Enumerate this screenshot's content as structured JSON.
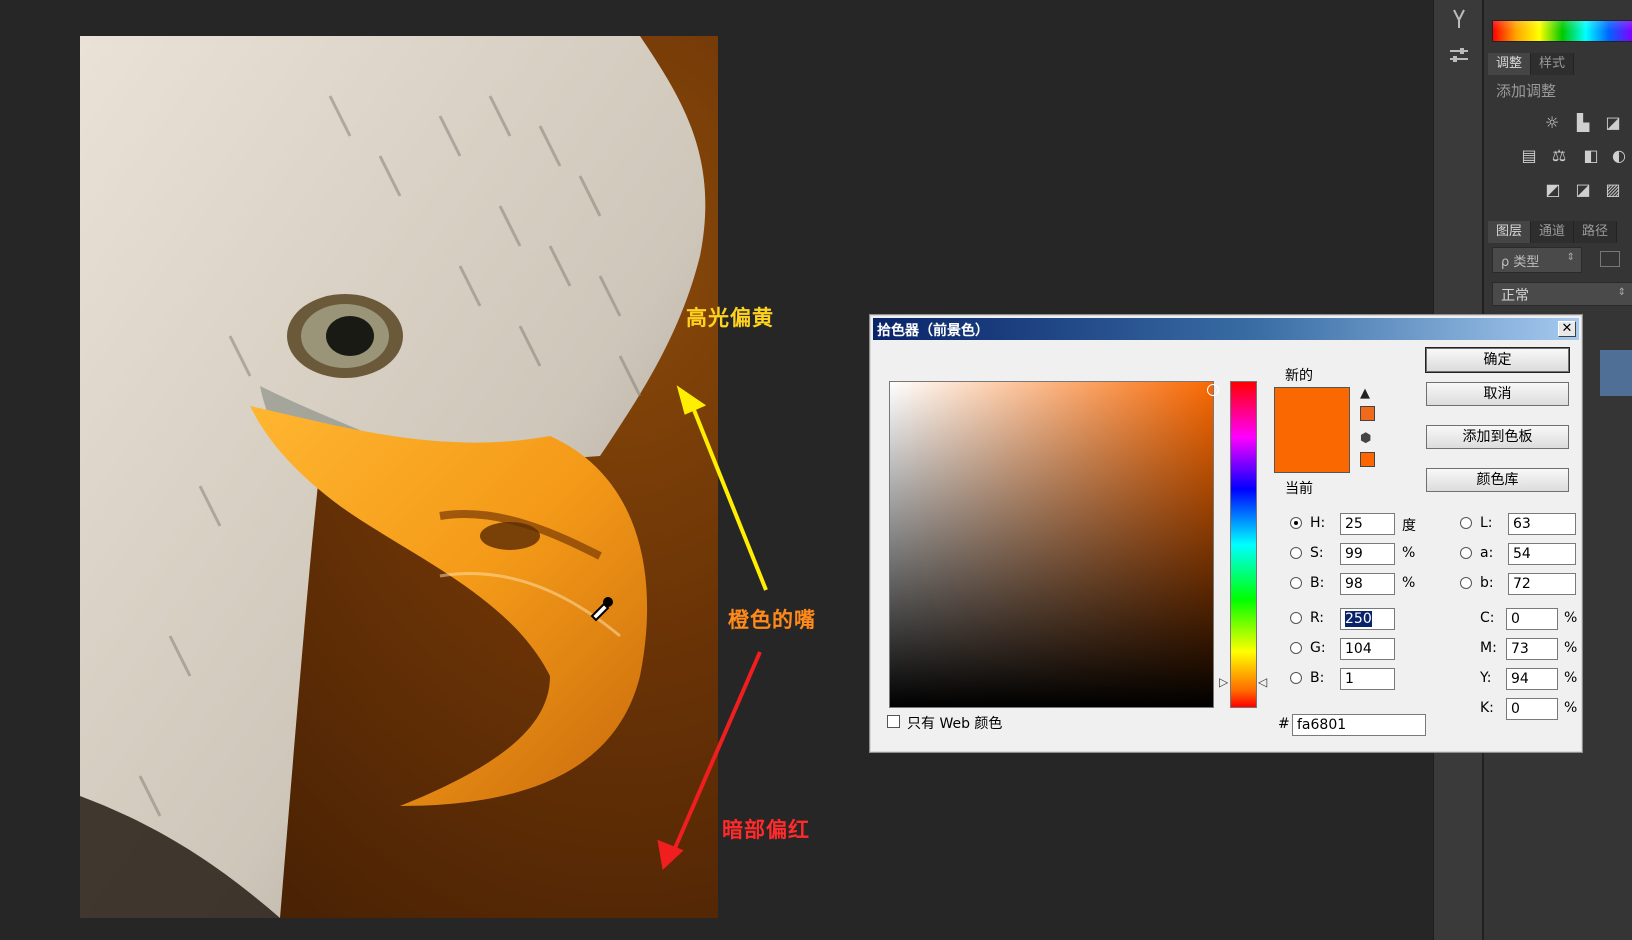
{
  "annotations": {
    "highlight": "高光偏黄",
    "beak": "橙色的嘴",
    "shadow": "暗部偏红"
  },
  "dialog": {
    "title": "拾色器（前景色）",
    "close_symbol": "✕",
    "new_label": "新的",
    "current_label": "当前",
    "new_color": "#fa6801",
    "current_color": "#fa6801",
    "gamut_warning_color": "#f06a1a",
    "web_safe_color": "#ff6600",
    "buttons": {
      "ok": "确定",
      "cancel": "取消",
      "add_to_swatches": "添加到色板",
      "color_libraries": "颜色库"
    },
    "hsb": {
      "h": {
        "label": "H:",
        "value": "25",
        "unit": "度"
      },
      "s": {
        "label": "S:",
        "value": "99",
        "unit": "%"
      },
      "b": {
        "label": "B:",
        "value": "98",
        "unit": "%"
      }
    },
    "rgb": {
      "r": {
        "label": "R:",
        "value": "250"
      },
      "g": {
        "label": "G:",
        "value": "104"
      },
      "b": {
        "label": "B:",
        "value": "1"
      }
    },
    "lab": {
      "l": {
        "label": "L:",
        "value": "63"
      },
      "a": {
        "label": "a:",
        "value": "54"
      },
      "b": {
        "label": "b:",
        "value": "72"
      }
    },
    "cmyk": {
      "c": {
        "label": "C:",
        "value": "0",
        "unit": "%"
      },
      "m": {
        "label": "M:",
        "value": "73",
        "unit": "%"
      },
      "y": {
        "label": "Y:",
        "value": "94",
        "unit": "%"
      },
      "k": {
        "label": "K:",
        "value": "0",
        "unit": "%"
      }
    },
    "hex_symbol": "#",
    "hex_value": "fa6801",
    "web_only_label": "只有 Web 颜色"
  },
  "panel": {
    "adjust_tabs": [
      "调整",
      "样式"
    ],
    "add_adjustment": "添加调整",
    "layer_tabs": [
      "图层",
      "通道",
      "路径"
    ],
    "kind_filter": "ρ 类型",
    "blend_mode": "正常"
  }
}
